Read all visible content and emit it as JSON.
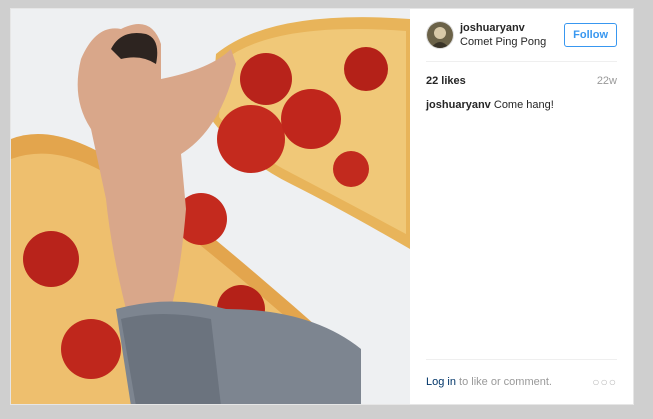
{
  "post": {
    "username": "joshuaryanv",
    "location": "Comet Ping Pong",
    "follow_label": "Follow",
    "likes": "22 likes",
    "time_ago": "22w",
    "caption_user": "joshuaryanv",
    "caption_text": " Come hang!",
    "login_link": "Log in",
    "login_suffix": " to like or comment.",
    "more_icon": "more-options-icon"
  },
  "colors": {
    "accent": "#3897f0",
    "text": "#262626",
    "muted": "#999999",
    "link": "#003569"
  }
}
